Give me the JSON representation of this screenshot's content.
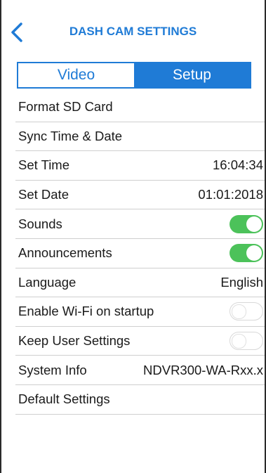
{
  "header": {
    "title": "DASH CAM SETTINGS"
  },
  "tabs": [
    {
      "label": "Video",
      "active": false
    },
    {
      "label": "Setup",
      "active": true
    }
  ],
  "settings": [
    {
      "label": "Format SD Card"
    },
    {
      "label": "Sync Time & Date"
    },
    {
      "label": "Set Time",
      "value": "16:04:34"
    },
    {
      "label": "Set Date",
      "value": "01:01:2018"
    },
    {
      "label": "Sounds",
      "toggle": true
    },
    {
      "label": "Announcements",
      "toggle": true
    },
    {
      "label": "Language",
      "value": "English"
    },
    {
      "label": "Enable Wi-Fi on startup",
      "toggle": false
    },
    {
      "label": "Keep User Settings",
      "toggle": false
    },
    {
      "label": "System Info",
      "value": "NDVR300-WA-Rxx.x"
    },
    {
      "label": "Default Settings"
    }
  ],
  "colors": {
    "accent": "#1f7bd6",
    "toggle_on": "#4cc25a"
  }
}
